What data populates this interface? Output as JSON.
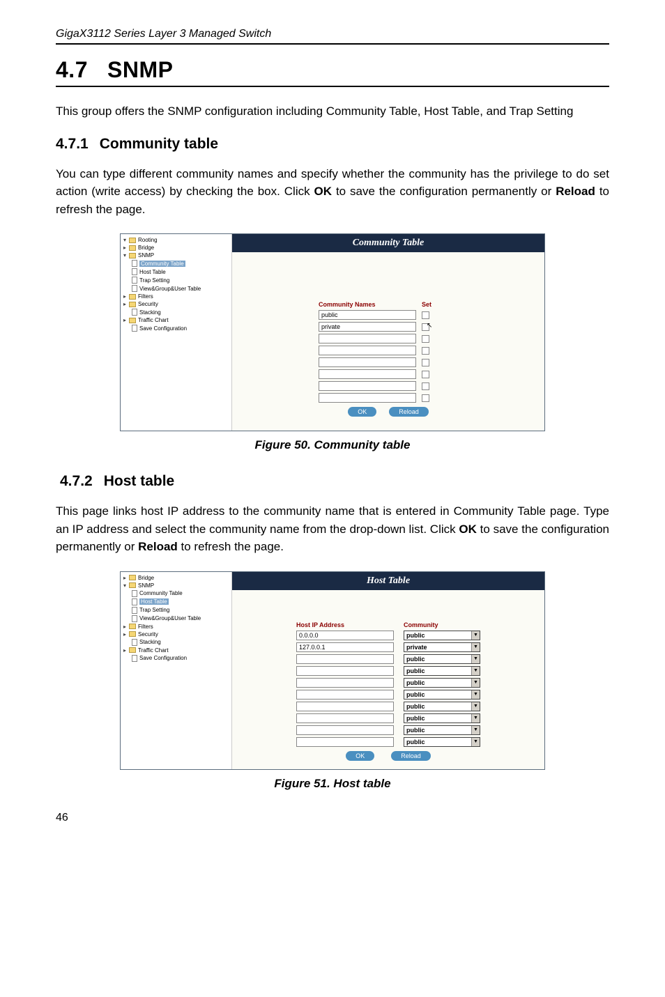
{
  "header": "GigaX3112 Series Layer 3 Managed Switch",
  "section": {
    "number": "4.7",
    "title": "SNMP"
  },
  "intro": "This group offers the SNMP configuration including Community Table, Host Table, and Trap Setting",
  "sub1": {
    "number": "4.7.1",
    "title": "Community table"
  },
  "sub1_desc_a": "You can type different community names and specify whether the community has the privilege to do set action (write access) by checking the box. Click ",
  "sub1_desc_ok": "OK",
  "sub1_desc_b": " to save the configuration permanently or ",
  "sub1_desc_reload": "Reload",
  "sub1_desc_c": " to refresh the page.",
  "fig1": {
    "header": "Community Table",
    "th1": "Community Names",
    "th2": "Set",
    "rows": [
      "public",
      "private",
      "",
      "",
      "",
      "",
      "",
      ""
    ],
    "ok": "OK",
    "reload": "Reload",
    "caption": "Figure 50. Community table"
  },
  "tree": {
    "rooting": "Rooting",
    "bridge": "Bridge",
    "snmp": "SNMP",
    "community_table": "Community Table",
    "host_table": "Host Table",
    "trap_setting": "Trap Setting",
    "view_group": "View&Group&User Table",
    "filters": "Filters",
    "security": "Security",
    "stacking": "Stacking",
    "traffic_chart": "Traffic Chart",
    "save_config": "Save Configuration"
  },
  "sub2": {
    "number": "4.7.2",
    "title": "Host table"
  },
  "sub2_desc_a": "This page links host IP address to the community name that is entered in Community Table page. Type an IP address and select the community name from the drop-down list. Click ",
  "sub2_desc_ok": "OK",
  "sub2_desc_b": " to save the configuration permanently or ",
  "sub2_desc_reload": "Reload",
  "sub2_desc_c": " to refresh the page.",
  "fig2": {
    "header": "Host Table",
    "th1": "Host IP Address",
    "th2": "Community",
    "rows": [
      {
        "ip": "0.0.0.0",
        "comm": "public"
      },
      {
        "ip": "127.0.0.1",
        "comm": "private"
      },
      {
        "ip": "",
        "comm": "public"
      },
      {
        "ip": "",
        "comm": "public"
      },
      {
        "ip": "",
        "comm": "public"
      },
      {
        "ip": "",
        "comm": "public"
      },
      {
        "ip": "",
        "comm": "public"
      },
      {
        "ip": "",
        "comm": "public"
      },
      {
        "ip": "",
        "comm": "public"
      },
      {
        "ip": "",
        "comm": "public"
      }
    ],
    "ok": "OK",
    "reload": "Reload",
    "caption": "Figure 51. Host table"
  },
  "page_number": "46"
}
